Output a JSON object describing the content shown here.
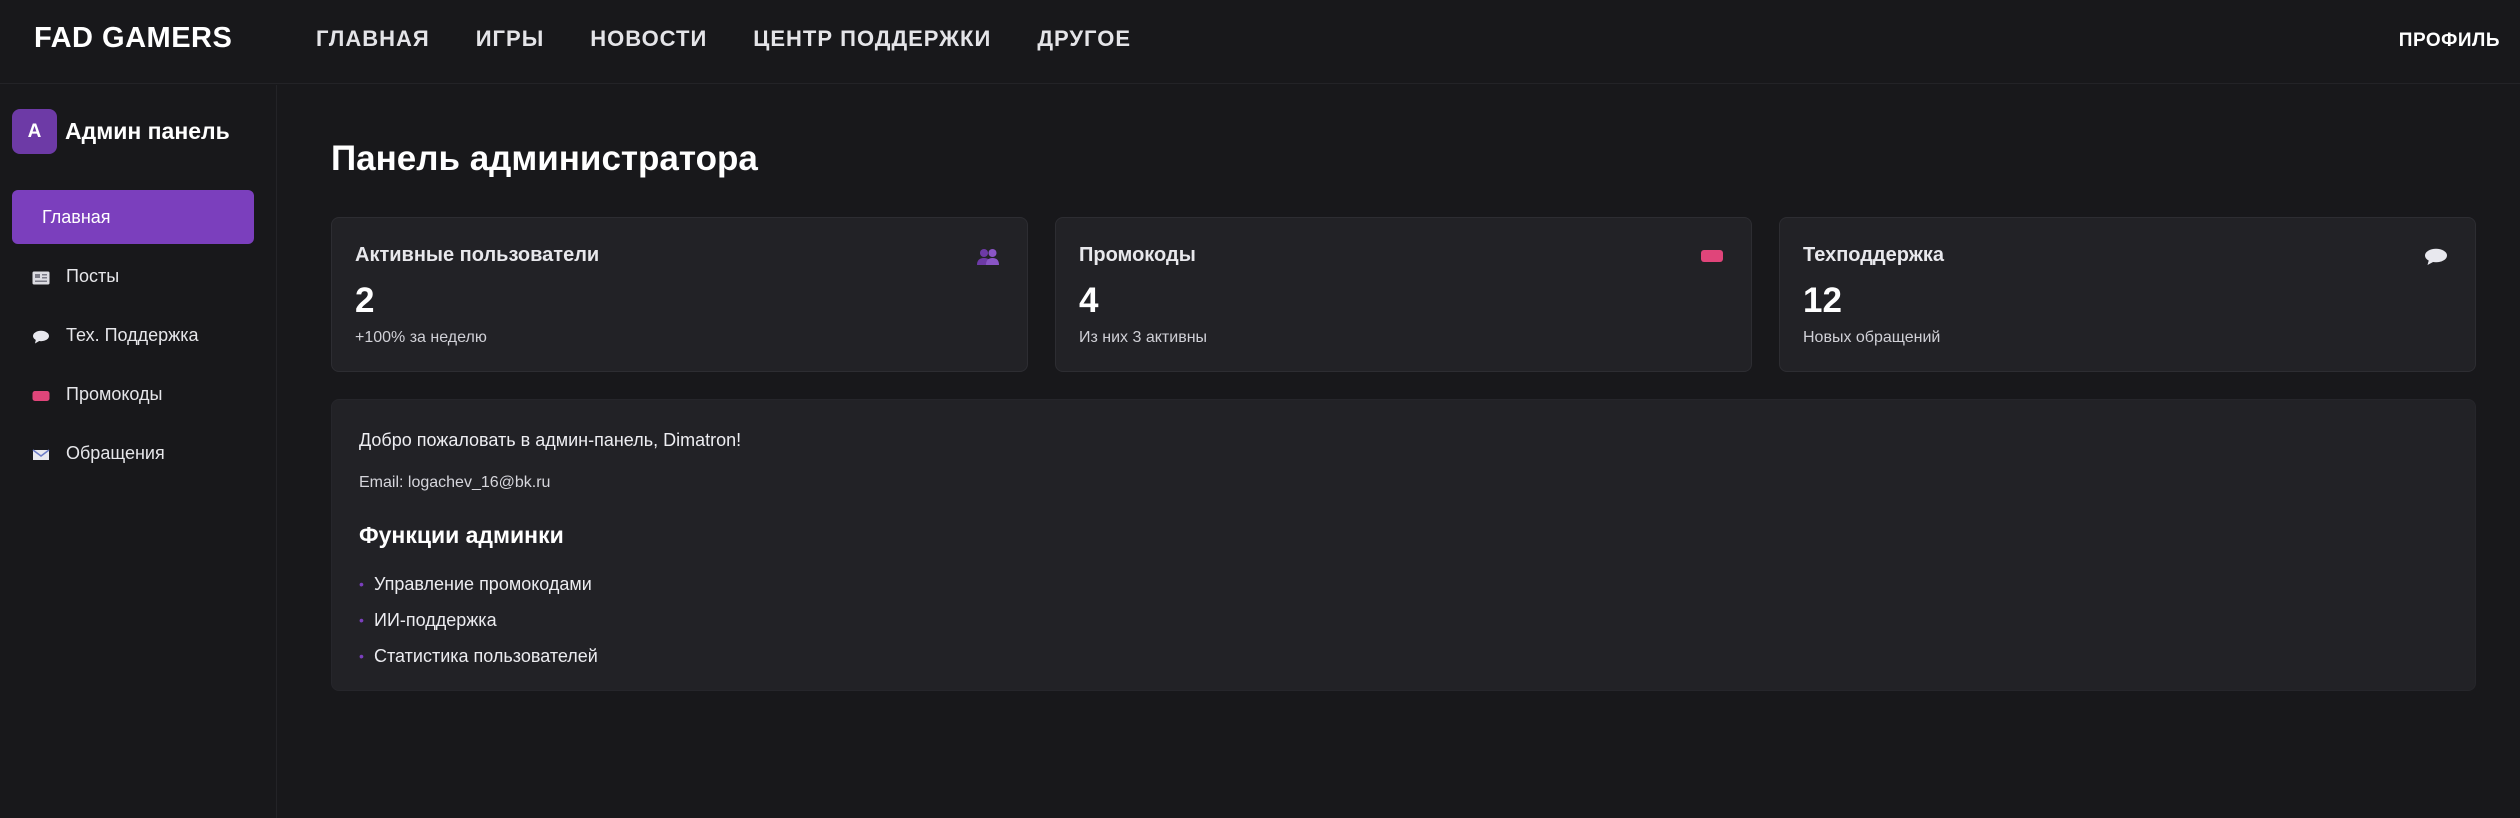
{
  "header": {
    "brand": "FAD GAMERS",
    "nav": [
      "ГЛАВНАЯ",
      "ИГРЫ",
      "НОВОСТИ",
      "ЦЕНТР ПОДДЕРЖКИ",
      "ДРУГОЕ"
    ],
    "profile": "ПРОФИЛЬ"
  },
  "sidebar": {
    "avatar_letter": "A",
    "title": "Админ панель",
    "items": [
      {
        "label": "Главная",
        "icon": "home",
        "active": true
      },
      {
        "label": "Посты",
        "icon": "newspaper-icon"
      },
      {
        "label": "Тех. Поддержка",
        "icon": "speech-bubble-icon"
      },
      {
        "label": "Промокоды",
        "icon": "ticket-icon"
      },
      {
        "label": "Обращения",
        "icon": "envelope-icon"
      }
    ]
  },
  "main": {
    "title": "Панель администратора",
    "cards": [
      {
        "label": "Активные пользователи",
        "value": "2",
        "sub": "+100% за неделю",
        "icon": "users-icon"
      },
      {
        "label": "Промокоды",
        "value": "4",
        "sub": "Из них 3 активны",
        "icon": "ticket-icon"
      },
      {
        "label": "Техподдержка",
        "value": "12",
        "sub": "Новых обращений",
        "icon": "speech-bubble-icon"
      }
    ],
    "welcome": {
      "greeting": "Добро пожаловать в админ-панель, Dimatron!",
      "email": "Email: logachev_16@bk.ru",
      "heading": "Функции админки",
      "features": [
        "Управление промокодами",
        "ИИ-поддержка",
        "Статистика пользователей"
      ]
    }
  },
  "colors": {
    "accent": "#7b3fbd",
    "background": "#18181b",
    "card": "#222226",
    "ticket": "#e0457a"
  }
}
